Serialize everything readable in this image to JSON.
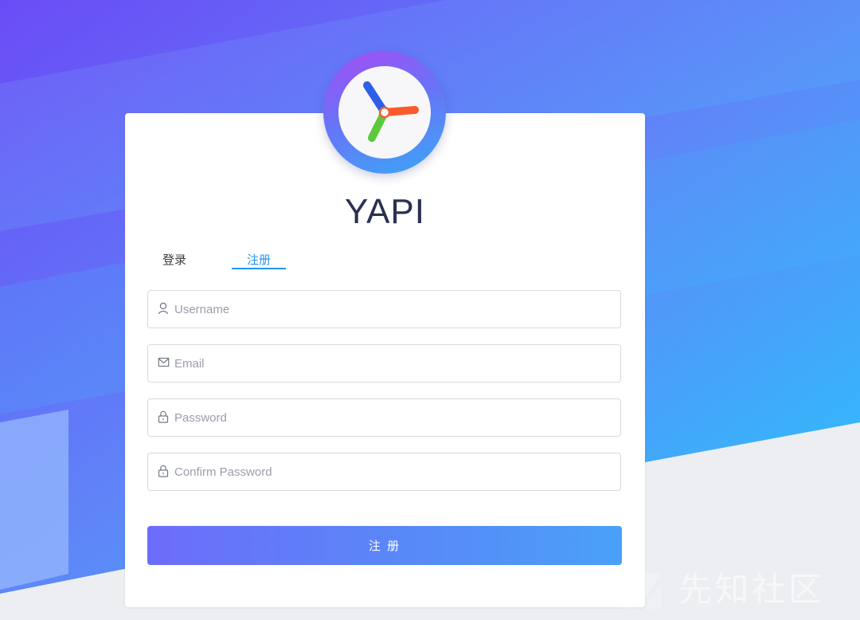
{
  "app": {
    "title": "YAPI"
  },
  "tabs": [
    {
      "label": "登录",
      "active": false
    },
    {
      "label": "注册",
      "active": true
    }
  ],
  "form": {
    "username": {
      "placeholder": "Username",
      "value": "",
      "icon": "user-icon"
    },
    "email": {
      "placeholder": "Email",
      "value": "",
      "icon": "mail-icon"
    },
    "password": {
      "placeholder": "Password",
      "value": "",
      "icon": "lock-icon"
    },
    "confirm_password": {
      "placeholder": "Confirm Password",
      "value": "",
      "icon": "lock-icon"
    },
    "submit_label": "注 册"
  },
  "watermark": {
    "text": "先知社区"
  },
  "colors": {
    "accent": "#2395f1",
    "button_start": "#6d6cfa",
    "button_end": "#4aa0f8",
    "title": "#2a3150",
    "background_gradient_start": "#6b5cf6",
    "background_gradient_end": "#2ec6fb"
  }
}
